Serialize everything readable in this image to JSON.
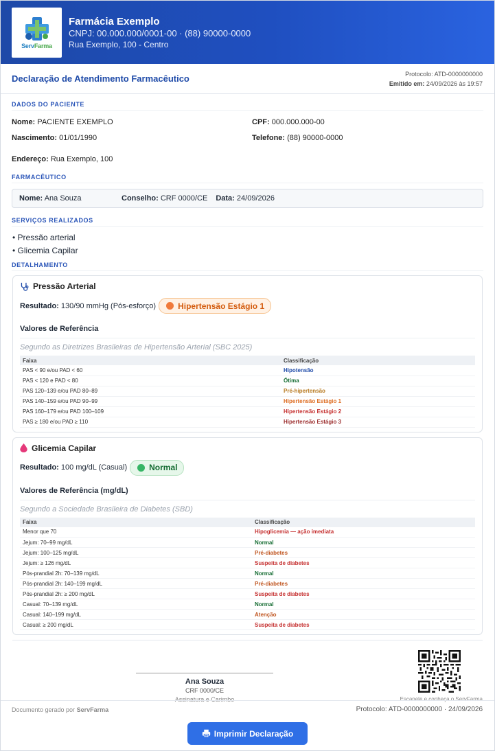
{
  "header": {
    "name": "Farmácia Exemplo",
    "cnpj_line": "CNPJ: 00.000.000/0001-00 · (88) 90000-0000",
    "address": "Rua Exemplo, 100 - Centro",
    "logo_text_a": "Serv",
    "logo_text_b": "Farma"
  },
  "titlebar": {
    "title": "Declaração de Atendimento Farmacêutico",
    "protocol": "Protocolo: ATD-0000000000",
    "emitted_label": "Emitido em:",
    "emitted_value": "24/09/2026 às 19:57"
  },
  "patient": {
    "section": "DADOS DO PACIENTE",
    "name_label": "Nome:",
    "name": "PACIENTE EXEMPLO",
    "cpf_label": "CPF:",
    "cpf": "000.000.000-00",
    "birth_label": "Nascimento:",
    "birth": "01/01/1990",
    "phone_label": "Telefone:",
    "phone": "(88) 90000-0000",
    "address_label": "Endereço:",
    "address": "Rua Exemplo, 100"
  },
  "pharmacist": {
    "section": "FARMACÊUTICO",
    "name_label": "Nome:",
    "name": "Ana Souza",
    "council_label": "Conselho:",
    "council": "CRF 0000/CE",
    "date_label": "Data:",
    "date": "24/09/2026"
  },
  "services": {
    "section": "SERVIÇOS REALIZADOS",
    "items": [
      "• Pressão arterial",
      "• Glicemia Capilar"
    ]
  },
  "details": {
    "section": "DETALHAMENTO",
    "bp": {
      "title": "Pressão Arterial",
      "result_label": "Resultado:",
      "result_value": "130/90 mmHg (Pós-esforço)",
      "badge": "Hipertensão Estágio 1",
      "ref_title": "Valores de Referência",
      "ref_source": "Segundo as Diretrizes Brasileiras de Hipertensão Arterial (SBC 2025)",
      "col_range": "Faixa",
      "col_class": "Classificação",
      "rows": [
        {
          "range": "PAS < 90 e/ou PAD < 60",
          "cls": "Hipotensão",
          "color": "#1e4aa8"
        },
        {
          "range": "PAS < 120 e PAD < 80",
          "cls": "Ótima",
          "color": "#136b31"
        },
        {
          "range": "PAS 120–139 e/ou PAD 80–89",
          "cls": "Pré-hipertensão",
          "color": "#b7791f"
        },
        {
          "range": "PAS 140–159 e/ou PAD 90–99",
          "cls": "Hipertensão Estágio 1",
          "color": "#dd6b20"
        },
        {
          "range": "PAS 160–179 e/ou PAD 100–109",
          "cls": "Hipertensão Estágio 2",
          "color": "#c53030"
        },
        {
          "range": "PAS ≥ 180 e/ou PAD ≥ 110",
          "cls": "Hipertensão Estágio 3",
          "color": "#9b2c2c"
        }
      ]
    },
    "glucose": {
      "title": "Glicemia Capilar",
      "result_label": "Resultado:",
      "result_value": "100 mg/dL (Casual)",
      "badge": "Normal",
      "ref_title": "Valores de Referência (mg/dL)",
      "ref_source": "Segundo a Sociedade Brasileira de Diabetes (SBD)",
      "col_range": "Faixa",
      "col_class": "Classificação",
      "rows": [
        {
          "range": "Menor que 70",
          "cls": "Hipoglicemia — ação imediata",
          "color": "#c53030"
        },
        {
          "range": "Jejum: 70–99 mg/dL",
          "cls": "Normal",
          "color": "#136b31"
        },
        {
          "range": "Jejum: 100–125 mg/dL",
          "cls": "Pré-diabetes",
          "color": "#c05621"
        },
        {
          "range": "Jejum: ≥ 126 mg/dL",
          "cls": "Suspeita de diabetes",
          "color": "#c53030"
        },
        {
          "range": "Pós-prandial 2h: 70–139 mg/dL",
          "cls": "Normal",
          "color": "#136b31"
        },
        {
          "range": "Pós-prandial 2h: 140–199 mg/dL",
          "cls": "Pré-diabetes",
          "color": "#c05621"
        },
        {
          "range": "Pós-prandial 2h: ≥ 200 mg/dL",
          "cls": "Suspeita de diabetes",
          "color": "#c53030"
        },
        {
          "range": "Casual: 70–139 mg/dL",
          "cls": "Normal",
          "color": "#136b31"
        },
        {
          "range": "Casual: 140–199 mg/dL",
          "cls": "Atenção",
          "color": "#c05621"
        },
        {
          "range": "Casual: ≥ 200 mg/dL",
          "cls": "Suspeita de diabetes",
          "color": "#c53030"
        }
      ]
    }
  },
  "signature": {
    "name": "Ana Souza",
    "crf": "CRF 0000/CE",
    "role": "Assinatura e Carimbo",
    "qr_caption": "Escanele e conheça o ServFarma"
  },
  "footer": {
    "generated_prefix": "Documento gerado por",
    "brand": "ServFarma",
    "protocol": "Protocolo: ATD-0000000000 · 24/09/2026"
  },
  "print_button": "Imprimir Declaração"
}
